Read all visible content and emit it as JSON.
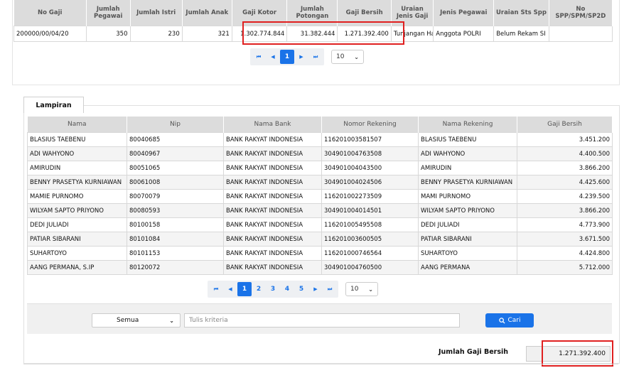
{
  "top_table": {
    "headers": [
      "No Gaji",
      "Jumlah Pegawai",
      "Jumlah Istri",
      "Jumlah Anak",
      "Gaji Kotor",
      "Jumlah Potongan",
      "Gaji Bersih",
      "Uraian Jenis Gaji",
      "Jenis Pegawai",
      "Uraian Sts Spp",
      "No SPP/SPM/SP2D"
    ],
    "row": [
      "200000/00/04/20",
      "350",
      "230",
      "321",
      "1.302.774.844",
      "31.382.444",
      "1.271.392.400",
      "Tunjangan Hari",
      "Anggota POLRI",
      "Belum Rekam SI",
      ""
    ],
    "pager": {
      "first": "⏮",
      "prev": "◀",
      "page": "1",
      "next": "▶",
      "last": "⏭",
      "page_size": "10"
    }
  },
  "lampiran": {
    "tab_label": "Lampiran",
    "headers": [
      "Nama",
      "Nip",
      "Nama Bank",
      "Nomor Rekening",
      "Nama Rekening",
      "Gaji Bersih"
    ],
    "rows": [
      [
        "BLASIUS TAEBENU",
        "80040685",
        "BANK RAKYAT INDONESIA",
        "116201003581507",
        "BLASIUS TAEBENU",
        "3.451.200"
      ],
      [
        "ADI WAHYONO",
        "80040967",
        "BANK RAKYAT INDONESIA",
        "304901004763508",
        "ADI WAHYONO",
        "4.400.500"
      ],
      [
        "AMIRUDIN",
        "80051065",
        "BANK RAKYAT INDONESIA",
        "304901004043500",
        "AMIRUDIN",
        "3.866.200"
      ],
      [
        "BENNY PRASETYA KURNIAWAN",
        "80061008",
        "BANK RAKYAT INDONESIA",
        "304901004024506",
        "BENNY PRASETYA KURNIAWAN",
        "4.425.600"
      ],
      [
        "MAMIE PURNOMO",
        "80070079",
        "BANK RAKYAT INDONESIA",
        "116201002273509",
        "MAMI PURNOMO",
        "4.239.500"
      ],
      [
        "WILYAM SAPTO PRIYONO",
        "80080593",
        "BANK RAKYAT INDONESIA",
        "304901004014501",
        "WILYAM SAPTO PRIYONO",
        "3.866.200"
      ],
      [
        "DEDI JULIADI",
        "80100158",
        "BANK RAKYAT INDONESIA",
        "116201005495508",
        "DEDI JULIADI",
        "4.773.900"
      ],
      [
        "PATIAR SIBARANI",
        "80101084",
        "BANK RAKYAT INDONESIA",
        "116201003600505",
        "PATIAR SIBARANI",
        "3.671.500"
      ],
      [
        "SUHARTOYO",
        "80101153",
        "BANK RAKYAT INDONESIA",
        "116201000746564",
        "SUHARTOYO",
        "4.424.800"
      ],
      [
        "AANG PERMANA, S.IP",
        "80120072",
        "BANK RAKYAT INDONESIA",
        "304901004760500",
        "AANG PERMANA",
        "5.712.000"
      ]
    ],
    "pager": {
      "first": "⏮",
      "prev": "◀",
      "pages": [
        "1",
        "2",
        "3",
        "4",
        "5"
      ],
      "next": "▶",
      "last": "⏭",
      "page_size": "10"
    },
    "filter": {
      "select_value": "Semua",
      "search_placeholder": "Tulis kriteria",
      "search_button": "Cari"
    },
    "total_label": "Jumlah Gaji Bersih",
    "total_value": "1.271.392.400"
  },
  "colors": {
    "accent": "#1a73e8",
    "highlight": "#e02020"
  },
  "icons": {
    "search": "search-icon",
    "dropdown": "chevron-down-icon"
  }
}
